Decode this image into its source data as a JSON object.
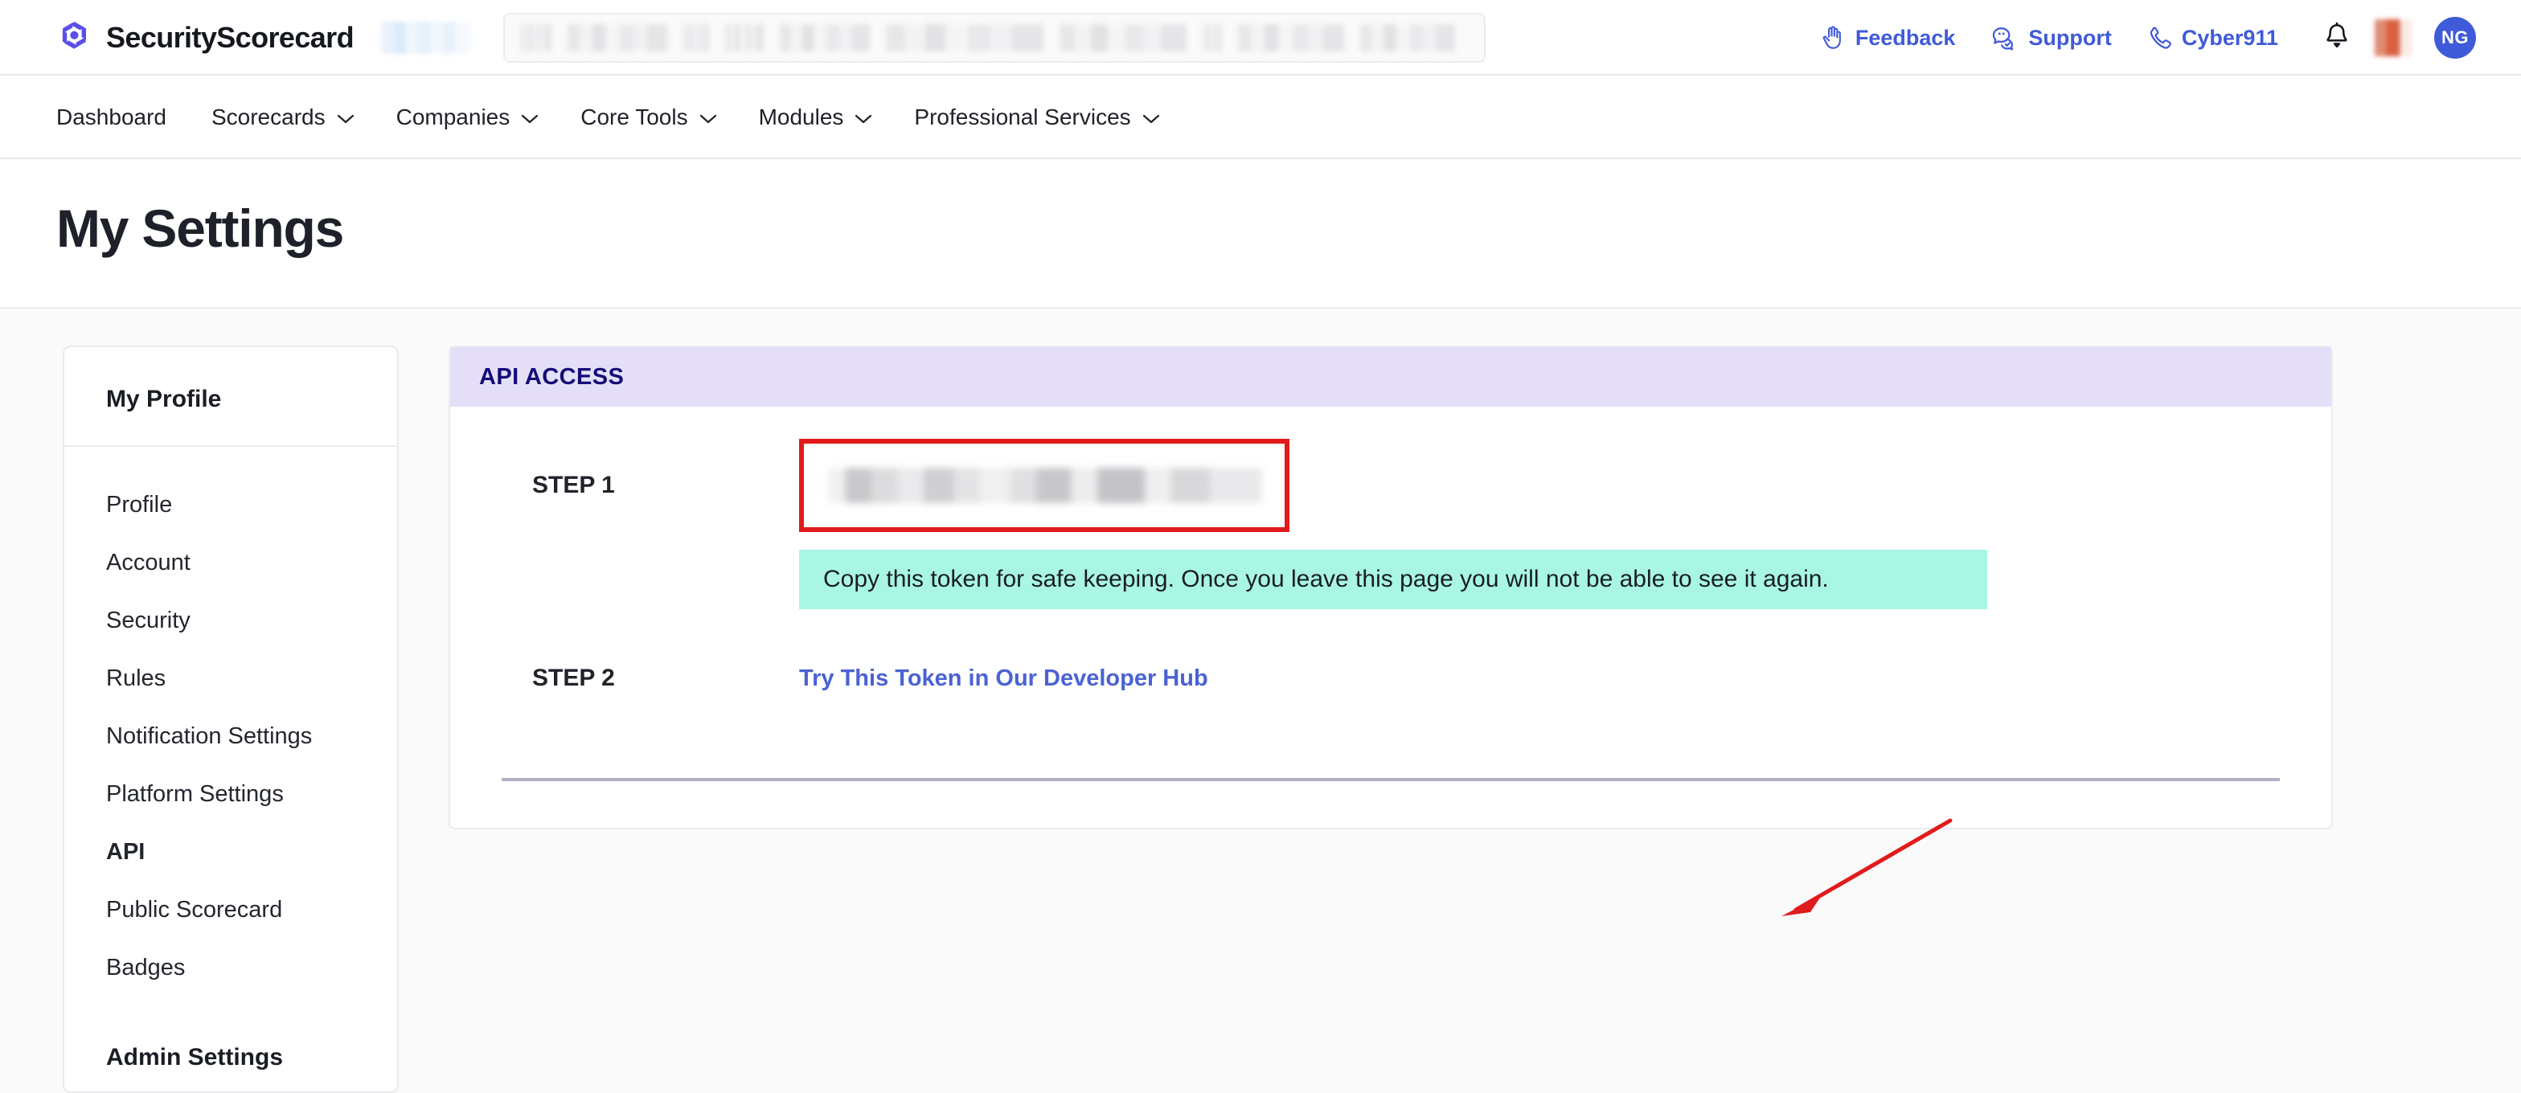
{
  "header": {
    "brand_name": "SecurityScorecard",
    "brand_logo_icon": "securityscorecard-logo-icon",
    "account_switcher_redacted": "",
    "search": {
      "placeholder": "",
      "value_redacted": ""
    },
    "links": [
      {
        "label": "Feedback",
        "icon": "hand-raised-icon"
      },
      {
        "label": "Support",
        "icon": "chat-bubble-check-icon"
      },
      {
        "label": "Cyber911",
        "icon": "phone-icon"
      }
    ],
    "notifications_icon": "bell-icon",
    "status_badge_redacted": "",
    "avatar_initials": "NG"
  },
  "nav": {
    "items": [
      {
        "label": "Dashboard",
        "has_caret": false
      },
      {
        "label": "Scorecards",
        "has_caret": true
      },
      {
        "label": "Companies",
        "has_caret": true
      },
      {
        "label": "Core Tools",
        "has_caret": true
      },
      {
        "label": "Modules",
        "has_caret": true
      },
      {
        "label": "Professional Services",
        "has_caret": true
      }
    ]
  },
  "page": {
    "title": "My Settings"
  },
  "sidebar": {
    "heading": "My Profile",
    "items": [
      {
        "label": "Profile",
        "active": false
      },
      {
        "label": "Account",
        "active": false
      },
      {
        "label": "Security",
        "active": false
      },
      {
        "label": "Rules",
        "active": false
      },
      {
        "label": "Notification Settings",
        "active": false
      },
      {
        "label": "Platform Settings",
        "active": false
      },
      {
        "label": "API",
        "active": true
      },
      {
        "label": "Public Scorecard",
        "active": false
      },
      {
        "label": "Badges",
        "active": false
      }
    ],
    "group_heading": "Admin Settings"
  },
  "api_card": {
    "header_label": "API ACCESS",
    "step1": {
      "label": "STEP 1",
      "token_value_redacted": "",
      "callout_text": "Copy this token for safe keeping. Once you leave this page you will not be able to see it again."
    },
    "step2": {
      "label": "STEP 2",
      "link_label": "Try This Token in Our Developer Hub"
    }
  },
  "annotation": {
    "highlight_box_color": "#E11B1B",
    "arrow_color": "#E11B1B",
    "arrow_name": "red-annotation-arrow"
  },
  "colors": {
    "brand_purple": "#5B4EE8",
    "link_blue": "#3F5BD9",
    "card_header_bg": "#E4DFF7",
    "card_header_text": "#140B78",
    "callout_green": "#A8F6E3",
    "dev_link_blue": "#4A62D4",
    "annotation_red": "#E11B1B",
    "avatar_blue": "#3F5BD9"
  }
}
